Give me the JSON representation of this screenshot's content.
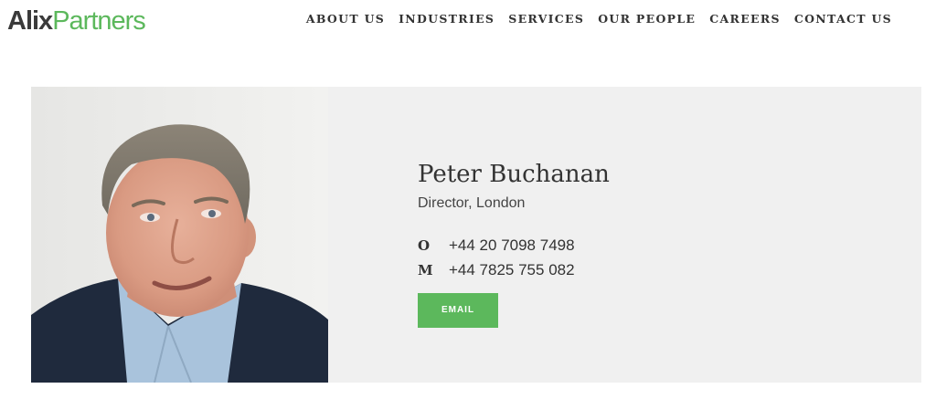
{
  "header": {
    "logo": {
      "part1": "Alix",
      "part2": "Partners"
    },
    "nav": [
      {
        "label": "ABOUT US"
      },
      {
        "label": "INDUSTRIES"
      },
      {
        "label": "SERVICES"
      },
      {
        "label": "OUR PEOPLE"
      },
      {
        "label": "CAREERS"
      },
      {
        "label": "CONTACT US"
      }
    ]
  },
  "profile": {
    "name": "Peter Buchanan",
    "title": "Director, London",
    "phones": [
      {
        "label": "O",
        "number": "+44 20 7098 7498"
      },
      {
        "label": "M",
        "number": "+44 7825 755 082"
      }
    ],
    "email_label": "EMAIL"
  },
  "colors": {
    "brand_green": "#5cb85c",
    "card_bg": "#f0f0f0",
    "text_dark": "#333333"
  }
}
